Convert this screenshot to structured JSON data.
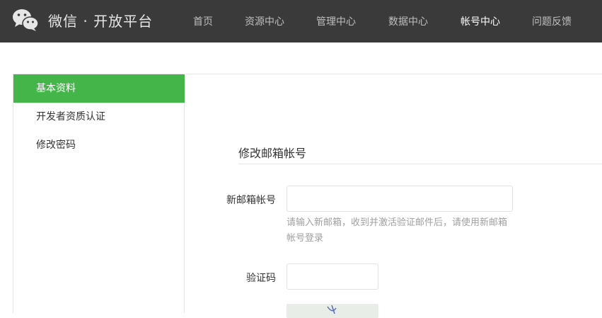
{
  "header": {
    "brand": "微信 · 开放平台",
    "logo_icon": "wechat-logo-icon",
    "nav": [
      {
        "label": "首页",
        "active": false
      },
      {
        "label": "资源中心",
        "active": false
      },
      {
        "label": "管理中心",
        "active": false
      },
      {
        "label": "数据中心",
        "active": false
      },
      {
        "label": "帐号中心",
        "active": true
      },
      {
        "label": "问题反馈",
        "active": false
      }
    ]
  },
  "sidebar": {
    "items": [
      {
        "label": "基本资料",
        "active": true
      },
      {
        "label": "开发者资质认证",
        "active": false
      },
      {
        "label": "修改密码",
        "active": false
      }
    ]
  },
  "form": {
    "title": "修改邮箱帐号",
    "email_label": "新邮箱帐号",
    "email_value": "",
    "email_hint": "请输入新邮箱，收到并激活验证邮件后，请使用新邮箱帐号登录",
    "code_label": "验证码",
    "code_value": ""
  },
  "colors": {
    "topbar": "#3a3a3a",
    "accent": "#44b549"
  }
}
